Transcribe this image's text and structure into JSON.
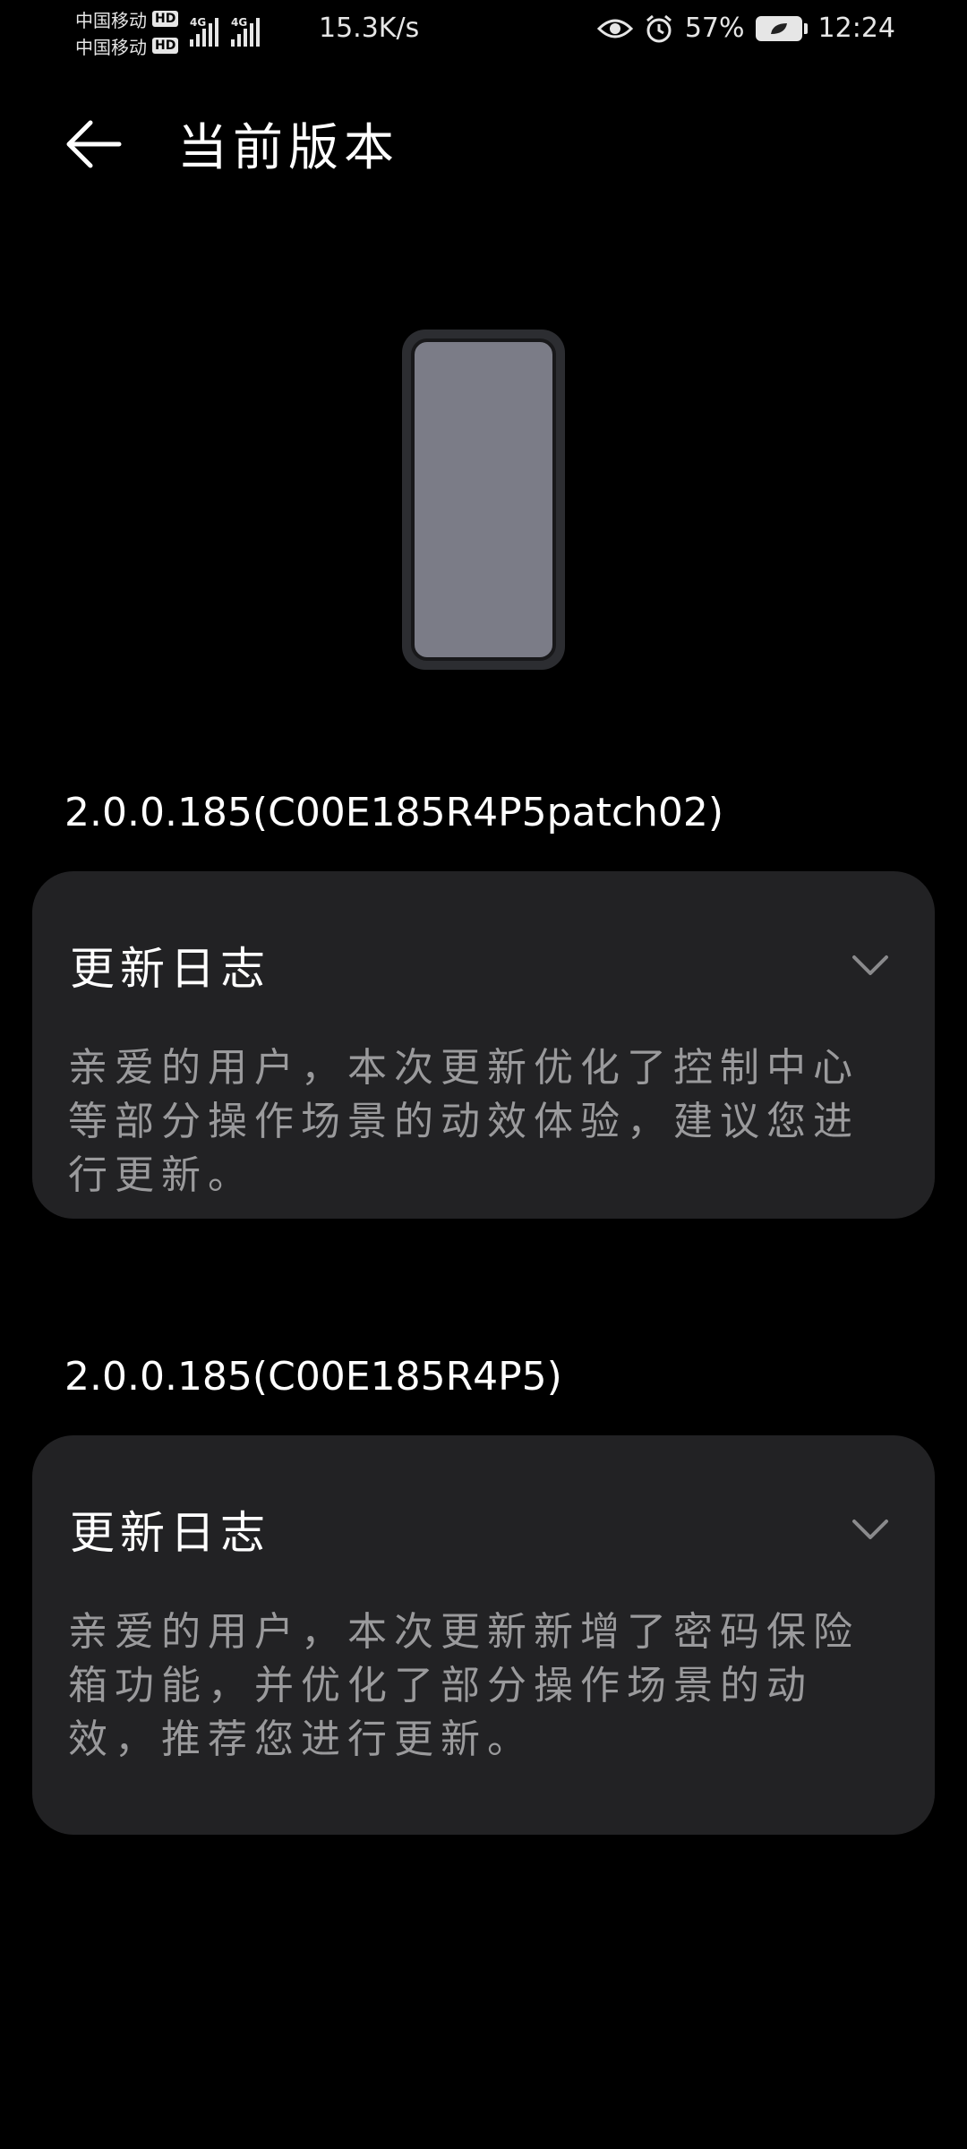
{
  "status_bar": {
    "carrier_1": "中国移动",
    "carrier_2": "中国移动",
    "hd_label": "HD",
    "network_1": "4G",
    "network_2": "4G",
    "net_speed": "15.3K/s",
    "battery": "57%",
    "time": "12:24",
    "icons": [
      "eye-icon",
      "alarm-icon",
      "battery-leaf-icon"
    ]
  },
  "header": {
    "title": "当前版本",
    "back_icon": "arrow-left-icon"
  },
  "versions": [
    {
      "version": "2.0.0.185(C00E185R4P5patch02)",
      "log_title": "更新日志",
      "description": "亲爱的用户，本次更新优化了控制中心等部分操作场景的动效体验，建议您进行更新。"
    },
    {
      "version": "2.0.0.185(C00E185R4P5)",
      "log_title": "更新日志",
      "description": "亲爱的用户，本次更新新增了密码保险箱功能，并优化了部分操作场景的动效，推荐您进行更新。"
    }
  ],
  "colors": {
    "background": "#000000",
    "card": "#222224",
    "description_text": "#9a9a9c",
    "phone_screen": "#7b7c87"
  }
}
